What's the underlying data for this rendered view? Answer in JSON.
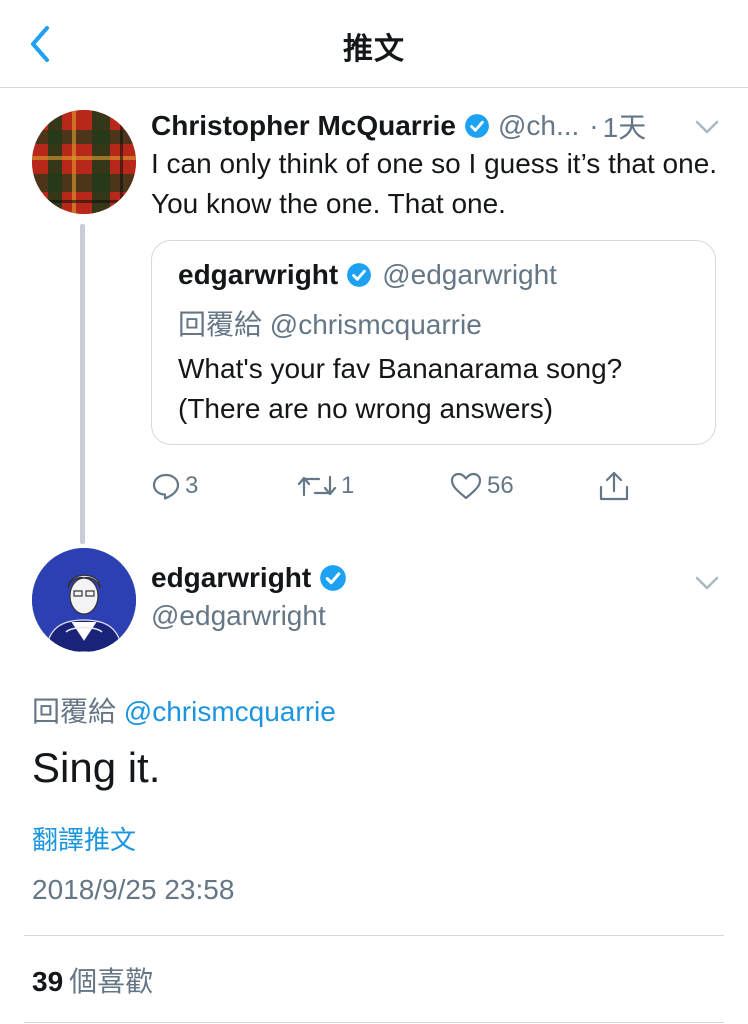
{
  "header": {
    "title": "推文",
    "back_icon": "chevron-left-icon"
  },
  "parent_tweet": {
    "author_name": "Christopher McQuarrie",
    "handle": "@ch...",
    "separator": "·",
    "time": "1天",
    "text": "I can only think of one so I guess it’s that one. You know the one. That one.",
    "quoted": {
      "author_name": "edgarwright",
      "handle": "@edgarwright",
      "reply_to": "回覆給 @chrismcquarrie",
      "text": "What's your fav Bananarama song? (There are no wrong answers)"
    },
    "actions": {
      "reply_count": "3",
      "retweet_count": "1",
      "like_count": "56"
    }
  },
  "main_tweet": {
    "author_name": "edgarwright",
    "handle": "@edgarwright",
    "reply_prefix": "回覆給",
    "reply_mention": "@chrismcquarrie",
    "text": "Sing it.",
    "translate_label": "翻譯推文",
    "timestamp": "2018/9/25 23:58",
    "likes_count": "39",
    "likes_label": "個喜歡"
  },
  "colors": {
    "accent": "#1b95e0",
    "verified": "#1da1f2",
    "secondary_text": "#657786",
    "border": "#d6d9dc"
  }
}
